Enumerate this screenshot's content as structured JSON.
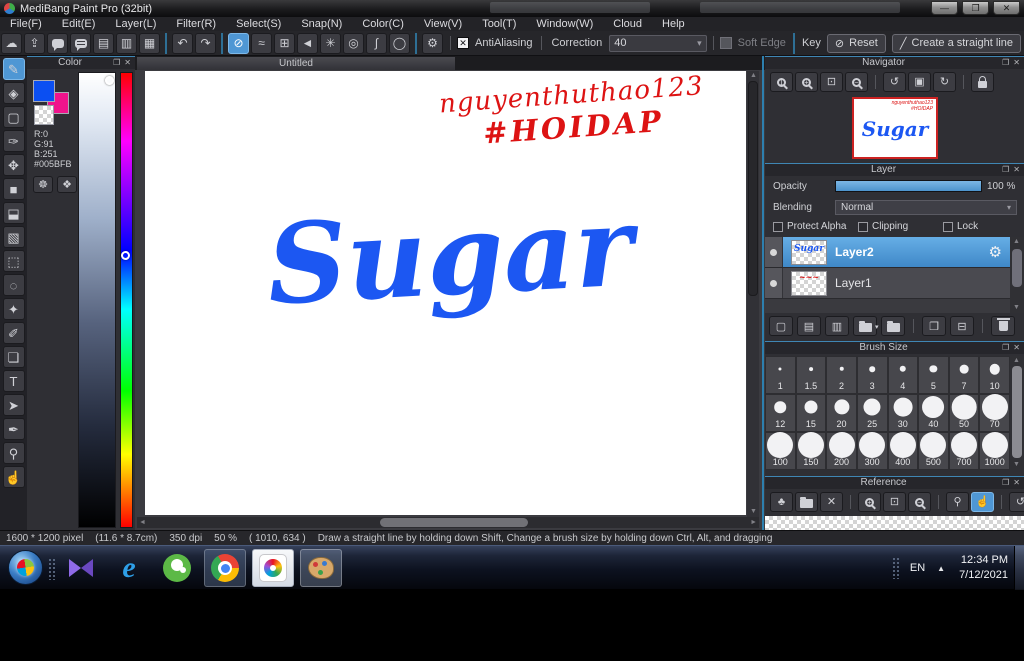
{
  "window": {
    "title": "MediBang Paint Pro (32bit)",
    "minimize": "—",
    "restore": "❐",
    "close": "✕"
  },
  "menu": {
    "items": [
      "File(F)",
      "Edit(E)",
      "Layer(L)",
      "Filter(R)",
      "Select(S)",
      "Snap(N)",
      "Color(C)",
      "View(V)",
      "Tool(T)",
      "Window(W)",
      "Cloud",
      "Help"
    ]
  },
  "toolbar": {
    "icons": [
      {
        "n": "cloud-icon",
        "g": "☁"
      },
      {
        "n": "upload-icon",
        "g": "⇪"
      },
      {
        "n": "comment-icon",
        "css": "bubble"
      },
      {
        "n": "chat-icon",
        "css": "bubble lines"
      },
      {
        "n": "document-icon",
        "g": "▤"
      },
      {
        "n": "panel-list-icon",
        "g": "▥"
      },
      {
        "n": "tile-view-icon",
        "g": "▦"
      },
      "sep",
      {
        "n": "undo-icon",
        "g": "↶"
      },
      {
        "n": "redo-icon",
        "g": "↷"
      },
      "sep",
      {
        "n": "snap-off-icon",
        "g": "⊘",
        "a": 1
      },
      {
        "n": "snap-parallel-icon",
        "g": "≈"
      },
      {
        "n": "snap-grid-icon",
        "g": "⊞"
      },
      {
        "n": "snap-vanishing-icon",
        "g": "◄"
      },
      {
        "n": "snap-radial-icon",
        "g": "✳"
      },
      {
        "n": "snap-concentric-icon",
        "g": "◎"
      },
      {
        "n": "snap-curve-icon",
        "g": "∫"
      },
      {
        "n": "snap-ellipse-icon",
        "g": "◯"
      },
      "sep",
      {
        "n": "snap-settings-icon",
        "g": "⚙"
      }
    ],
    "antialiasing_label": "AntiAliasing",
    "correction_label": "Correction",
    "correction_value": "40",
    "soft_edge_label": "Soft Edge",
    "key_label": "Key",
    "reset_label": "Reset",
    "straight_line_label": "Create a straight line"
  },
  "tools": {
    "items": [
      {
        "n": "tool-brush",
        "g": "✎",
        "a": 1
      },
      {
        "n": "tool-eraser",
        "g": "◈"
      },
      {
        "n": "tool-shape-brush",
        "g": "▢"
      },
      {
        "n": "tool-control-pen",
        "g": "✑"
      },
      "div",
      {
        "n": "tool-move",
        "g": "✥"
      },
      {
        "n": "tool-fill-rect",
        "g": "■"
      },
      {
        "n": "tool-bucket",
        "g": "⬓"
      },
      {
        "n": "tool-gradient",
        "g": "▧"
      },
      "div",
      {
        "n": "tool-select-rect",
        "g": "⬚"
      },
      {
        "n": "tool-lasso",
        "g": "◌"
      },
      {
        "n": "tool-magic-wand",
        "g": "✦"
      },
      {
        "n": "tool-select-pen",
        "g": "✐"
      },
      {
        "n": "tool-select-eraser",
        "g": "❏"
      },
      "div",
      {
        "n": "tool-text",
        "g": "T"
      },
      {
        "n": "tool-transform",
        "g": "➤"
      },
      {
        "n": "tool-divide",
        "g": "✒"
      },
      "div",
      {
        "n": "tool-eyedropper",
        "g": "⚲"
      },
      {
        "n": "tool-hand",
        "g": "☝"
      }
    ]
  },
  "color_panel": {
    "title": "Color",
    "r": "R:0",
    "g": "G:91",
    "b": "B:251",
    "hex": "#005BFB",
    "foreground_color": "#0b4ff2",
    "background_color": "#f0148c",
    "buttons": [
      {
        "n": "color-wheel-icon",
        "g": "☸"
      },
      {
        "n": "color-palette-icon",
        "g": "❖"
      }
    ]
  },
  "canvas": {
    "tab": "Untitled",
    "artwork_text": "Sugar",
    "artwork_color": "#1c57f2",
    "annotation_line1": "nguyenthuthao123",
    "annotation_line2": "#HOIDAP",
    "annotation_color": "#dd1313"
  },
  "navigator": {
    "title": "Navigator",
    "buttons": [
      {
        "n": "nav-zoom-actual-icon",
        "css": "mag",
        "t": "1"
      },
      {
        "n": "nav-zoom-in-icon",
        "css": "mag",
        "t": "+"
      },
      {
        "n": "nav-zoom-fit-icon",
        "g": "⊡"
      },
      {
        "n": "nav-zoom-out-icon",
        "css": "mag",
        "t": "−"
      },
      "sep",
      {
        "n": "nav-rotate-left-icon",
        "g": "↺"
      },
      {
        "n": "nav-fit-screen-icon",
        "g": "▣"
      },
      {
        "n": "nav-rotate-reset-icon",
        "g": "↻"
      },
      "sep",
      {
        "n": "nav-lock-icon",
        "css": "lock"
      }
    ]
  },
  "layer_panel": {
    "title": "Layer",
    "opacity_label": "Opacity",
    "opacity_value": "100 %",
    "blending_label": "Blending",
    "blending_value": "Normal",
    "checkboxes": [
      "Protect Alpha",
      "Clipping",
      "Lock"
    ],
    "layers": [
      {
        "name": "Layer2",
        "selected": true,
        "thumb": "sugar"
      },
      {
        "name": "Layer1",
        "selected": false,
        "thumb": "scribble"
      }
    ],
    "buttons": [
      {
        "n": "layer-new-icon",
        "g": "▢"
      },
      {
        "n": "layer-new-8bit-icon",
        "g": "▤"
      },
      {
        "n": "layer-new-1bit-icon",
        "g": "▥"
      },
      {
        "n": "layer-add-folder-icon",
        "css": "folder",
        "t": "▾"
      },
      {
        "n": "layer-folder-icon",
        "css": "folder"
      },
      "sep",
      {
        "n": "layer-duplicate-icon",
        "g": "❐"
      },
      {
        "n": "layer-merge-icon",
        "g": "⊟"
      },
      "sep",
      {
        "n": "layer-delete-icon",
        "css": "trash"
      }
    ]
  },
  "brush_panel": {
    "title": "Brush Size",
    "sizes": [
      "1",
      "1.5",
      "2",
      "3",
      "4",
      "5",
      "7",
      "10",
      "12",
      "15",
      "20",
      "25",
      "30",
      "40",
      "50",
      "70",
      "100",
      "150",
      "200",
      "300",
      "400",
      "500",
      "700",
      "1000"
    ]
  },
  "reference_panel": {
    "title": "Reference",
    "buttons": [
      {
        "n": "ref-import-icon",
        "g": "♣"
      },
      {
        "n": "ref-open-icon",
        "css": "folder"
      },
      {
        "n": "ref-clear-icon",
        "g": "✕"
      },
      "sep",
      {
        "n": "ref-zoom-in-icon",
        "css": "mag",
        "t": "+"
      },
      {
        "n": "ref-zoom-fit-icon",
        "g": "⊡"
      },
      {
        "n": "ref-zoom-out-icon",
        "css": "mag",
        "t": "−"
      },
      "sep",
      {
        "n": "ref-eyedropper-icon",
        "g": "⚲"
      },
      {
        "n": "ref-hand-icon",
        "g": "☝",
        "a": 1
      },
      "sep",
      {
        "n": "ref-rotate-left-icon",
        "g": "↺"
      },
      {
        "n": "ref-fit-screen-icon",
        "g": "▣"
      },
      {
        "n": "ref-rotate-reset-icon",
        "g": "↻"
      }
    ]
  },
  "status_bar": {
    "segments": [
      "1600 * 1200 pixel",
      "(11.6 * 8.7cm)",
      "350 dpi",
      "50 %",
      "( 1010, 634 )",
      "Draw a straight line by holding down Shift, Change a brush size by holding down Ctrl, Alt, and dragging"
    ]
  },
  "taskbar": {
    "language": "EN",
    "caret": "▲",
    "time": "12:34 PM",
    "date": "7/12/2021"
  },
  "colors": {
    "accent": "#4f97d4",
    "panel_line": "#3f86b4",
    "selection": "#4f97d4"
  }
}
